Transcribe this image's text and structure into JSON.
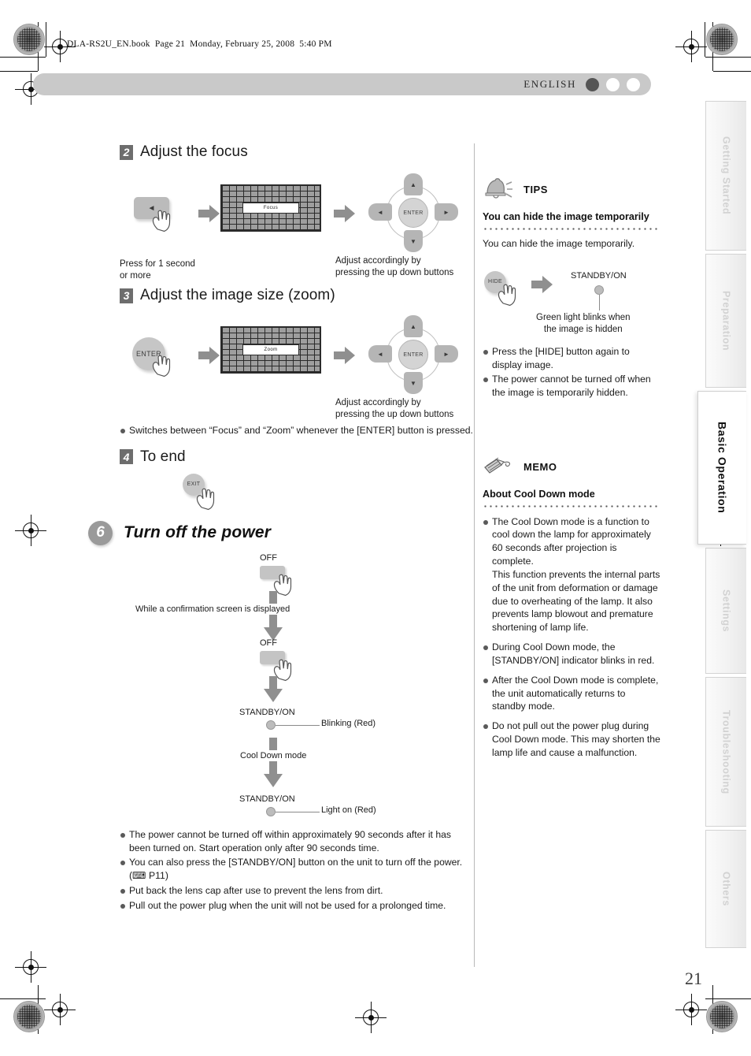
{
  "header": {
    "file_line": "DLA-RS2U_EN.book  Page 21  Monday, February 25, 2008  5:40 PM"
  },
  "banner": {
    "language": "ENGLISH",
    "dots": [
      "filled",
      "empty",
      "empty"
    ]
  },
  "left_column": {
    "step2": {
      "number": "2",
      "title": "Adjust the focus",
      "press_caption": "Press for 1 second\nor more",
      "screen_label": "Focus",
      "dpad": {
        "up": "▲",
        "down": "▼",
        "left": "◄",
        "right": "►",
        "center": "ENTER"
      },
      "adjust_caption": "Adjust accordingly by\npressing the up down buttons"
    },
    "step3": {
      "number": "3",
      "title": "Adjust the image size (zoom)",
      "button_label": "ENTER",
      "screen_label": "Zoom",
      "dpad": {
        "up": "▲",
        "down": "▼",
        "left": "◄",
        "right": "►",
        "center": "ENTER"
      },
      "adjust_caption": "Adjust accordingly by\npressing the up down buttons"
    },
    "note_bullet": "Switches between “Focus” and “Zoom” whenever the [ENTER] button is pressed.",
    "step4": {
      "number": "4",
      "title": "To end",
      "button_label": "EXIT"
    },
    "section6": {
      "number": "6",
      "title": "Turn off the power",
      "flow": {
        "off_label_1": "OFF",
        "confirm_text": "While a confirmation screen is displayed",
        "off_label_2": "OFF",
        "standby_label_1": "STANDBY/ON",
        "blinking_red": "Blinking (Red)",
        "cool_down": "Cool Down mode",
        "standby_label_2": "STANDBY/ON",
        "light_on_red": "Light on (Red)"
      },
      "bullets": [
        "The power cannot be turned off within approximately 90 seconds after it has been turned on. Start operation only after 90 seconds time.",
        "You can also press the [STANDBY/ON] button on the unit to turn off the power. (⌨ P11)",
        "Put back the lens cap after use to prevent the lens from dirt.",
        "Pull out the power plug when the unit will not be used for a prolonged time."
      ]
    }
  },
  "right_column": {
    "tips": {
      "kind": "TIPS",
      "title": "You can hide the image temporarily",
      "body": "You can hide the image temporarily.",
      "diagram": {
        "hide_button": "HIDE",
        "standby_label": "STANDBY/ON",
        "caption": "Green light blinks when\nthe image is hidden"
      },
      "bullets": [
        "Press the [HIDE] button again to display image.",
        "The power cannot be turned off when the image is temporarily hidden."
      ]
    },
    "memo": {
      "kind": "MEMO",
      "title": "About Cool Down mode",
      "bullets": [
        "The Cool Down mode is a function to cool down the lamp for approximately 60 seconds after projection is complete.\nThis function prevents the internal parts of the unit from deformation or damage due to overheating of the lamp. It also prevents lamp blowout and premature shortening of lamp life.",
        "During Cool Down mode, the [STANDBY/ON] indicator blinks in red.",
        "After the Cool Down mode is complete, the unit automatically returns to standby mode.",
        "Do not pull out the power plug during Cool Down mode. This may shorten the lamp life and cause a malfunction."
      ]
    }
  },
  "tabs": [
    {
      "label": "Getting Started",
      "active": false
    },
    {
      "label": "Preparation",
      "active": false
    },
    {
      "label": "Basic Operation",
      "active": true
    },
    {
      "label": "Settings",
      "active": false
    },
    {
      "label": "Troubleshooting",
      "active": false
    },
    {
      "label": "Others",
      "active": false
    }
  ],
  "page_number": "21",
  "colors": {
    "banner_bg": "#c9c9c9",
    "step_num_bg": "#6d6d6d",
    "section_circle_bg": "#9a9a9a",
    "arrow_gray": "#8f8f8f",
    "button_gray": "#c4c4c4"
  }
}
